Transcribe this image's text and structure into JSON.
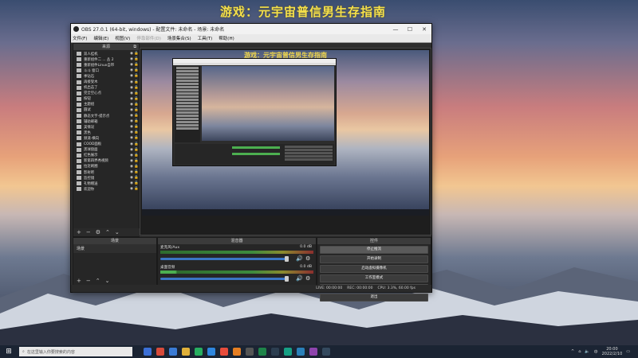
{
  "stream_title": "游戏：元宇宙普信男生存指南",
  "window": {
    "title": "OBS 27.0.1 (64-bit, windows) - 配置文件: 未命名 - 场景: 未命名",
    "min": "—",
    "max": "☐",
    "close": "✕"
  },
  "menu": [
    "文件(F)",
    "编辑(E)",
    "视图(V)",
    "停靠部件(D)",
    "场景集合(S)",
    "工具(T)",
    "帮助(H)"
  ],
  "sources_panel": {
    "title": "来源",
    "items": [
      "双人挂机",
      "重新组件二 ... 丛 2",
      "重新组件Linux自带",
      "斗斗 窗口",
      "季钻石",
      "再接受木",
      "机出击了",
      "完全空心点",
      "按钮",
      "主题组",
      "圆试",
      "静态文字-提示点",
      "辅助邮箱",
      "美情况",
      "黑色",
      "频道-横向",
      "COOD面板",
      "黑球盘面",
      "红色展示",
      "新第四界秀视频",
      "拉近刷圈",
      "影射吧",
      "监控镜",
      "礼物赠送",
      "欢迎你"
    ]
  },
  "scenes_panel": {
    "title": "场景",
    "items": [
      "场景"
    ]
  },
  "mixer_panel": {
    "title": "混音器",
    "channels": [
      {
        "name": "麦克风/Aux",
        "db": "0.0 dB"
      },
      {
        "name": "桌面音频",
        "db": "0.0 dB"
      }
    ]
  },
  "controls_panel": {
    "title": "控件",
    "buttons": [
      "停止推流",
      "开始录制",
      "启动虚拟摄像机",
      "工作室模式",
      "设置",
      "退出"
    ]
  },
  "status_bar": {
    "live": "LIVE: 00:00:00",
    "rec": "REC: 00:00:00",
    "cpu": "CPU: 3.3%, 60.00 fps"
  },
  "taskbar": {
    "search_placeholder": "在这里输入你要搜索的内容",
    "time": "20:00",
    "date": "2022/2/10"
  },
  "colors": {
    "accent_title": "#f5e04a",
    "obs_bg": "#2e2e2e",
    "volume_slider": "#3a75c4",
    "meter_green": "#4caf50"
  }
}
